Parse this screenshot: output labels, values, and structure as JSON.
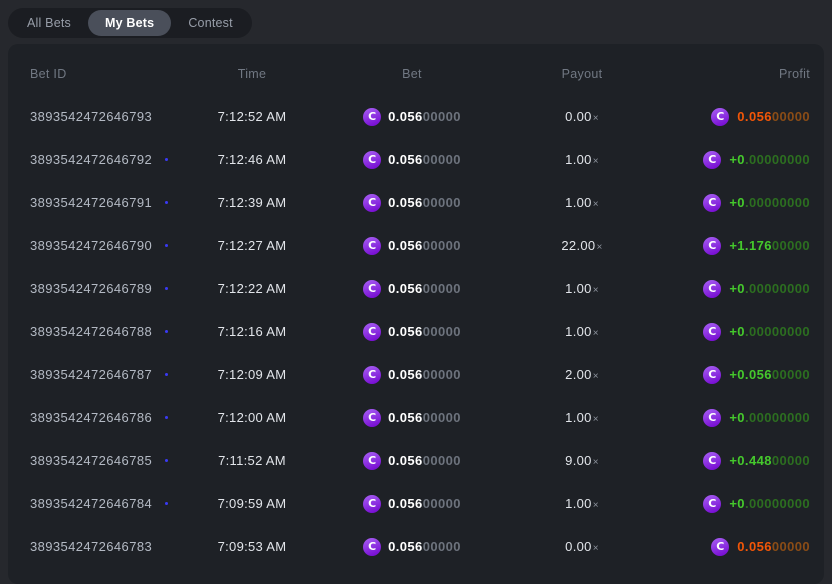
{
  "tabs": [
    {
      "label": "All Bets",
      "active": false
    },
    {
      "label": "My Bets",
      "active": true
    },
    {
      "label": "Contest",
      "active": false
    }
  ],
  "colors": {
    "accent_purple": "#8b2fd6",
    "win": "#45c92c",
    "win_dim": "#2c6e20",
    "loss": "#f25607",
    "loss_dim": "#8a4c16",
    "coin_light": "#a358f0",
    "coin_dark": "#7a11d4",
    "pending_dot": "#3a3af5"
  },
  "icons": {
    "coin_glyph": "C"
  },
  "table": {
    "columns": [
      "Bet ID",
      "Time",
      "Bet",
      "Payout",
      "Profit"
    ],
    "rows": [
      {
        "bet_id": "3893542472646793",
        "has_dot": false,
        "time": "7:12:52 AM",
        "bet_bold": "0.056",
        "bet_dim": "00000",
        "payout": "0.00",
        "profit_bold": "0.056",
        "profit_dim": "00000",
        "result": "loss"
      },
      {
        "bet_id": "3893542472646792",
        "has_dot": true,
        "time": "7:12:46 AM",
        "bet_bold": "0.056",
        "bet_dim": "00000",
        "payout": "1.00",
        "profit_bold": "+0",
        "profit_dim": ".00000000",
        "result": "win"
      },
      {
        "bet_id": "3893542472646791",
        "has_dot": true,
        "time": "7:12:39 AM",
        "bet_bold": "0.056",
        "bet_dim": "00000",
        "payout": "1.00",
        "profit_bold": "+0",
        "profit_dim": ".00000000",
        "result": "win"
      },
      {
        "bet_id": "3893542472646790",
        "has_dot": true,
        "time": "7:12:27 AM",
        "bet_bold": "0.056",
        "bet_dim": "00000",
        "payout": "22.00",
        "profit_bold": "+1.176",
        "profit_dim": "00000",
        "result": "win"
      },
      {
        "bet_id": "3893542472646789",
        "has_dot": true,
        "time": "7:12:22 AM",
        "bet_bold": "0.056",
        "bet_dim": "00000",
        "payout": "1.00",
        "profit_bold": "+0",
        "profit_dim": ".00000000",
        "result": "win"
      },
      {
        "bet_id": "3893542472646788",
        "has_dot": true,
        "time": "7:12:16 AM",
        "bet_bold": "0.056",
        "bet_dim": "00000",
        "payout": "1.00",
        "profit_bold": "+0",
        "profit_dim": ".00000000",
        "result": "win"
      },
      {
        "bet_id": "3893542472646787",
        "has_dot": true,
        "time": "7:12:09 AM",
        "bet_bold": "0.056",
        "bet_dim": "00000",
        "payout": "2.00",
        "profit_bold": "+0.056",
        "profit_dim": "00000",
        "result": "win"
      },
      {
        "bet_id": "3893542472646786",
        "has_dot": true,
        "time": "7:12:00 AM",
        "bet_bold": "0.056",
        "bet_dim": "00000",
        "payout": "1.00",
        "profit_bold": "+0",
        "profit_dim": ".00000000",
        "result": "win"
      },
      {
        "bet_id": "3893542472646785",
        "has_dot": true,
        "time": "7:11:52 AM",
        "bet_bold": "0.056",
        "bet_dim": "00000",
        "payout": "9.00",
        "profit_bold": "+0.448",
        "profit_dim": "00000",
        "result": "win"
      },
      {
        "bet_id": "3893542472646784",
        "has_dot": true,
        "time": "7:09:59 AM",
        "bet_bold": "0.056",
        "bet_dim": "00000",
        "payout": "1.00",
        "profit_bold": "+0",
        "profit_dim": ".00000000",
        "result": "win"
      },
      {
        "bet_id": "3893542472646783",
        "has_dot": false,
        "time": "7:09:53 AM",
        "bet_bold": "0.056",
        "bet_dim": "00000",
        "payout": "0.00",
        "profit_bold": "0.056",
        "profit_dim": "00000",
        "result": "loss"
      }
    ],
    "payout_suffix": "×"
  }
}
